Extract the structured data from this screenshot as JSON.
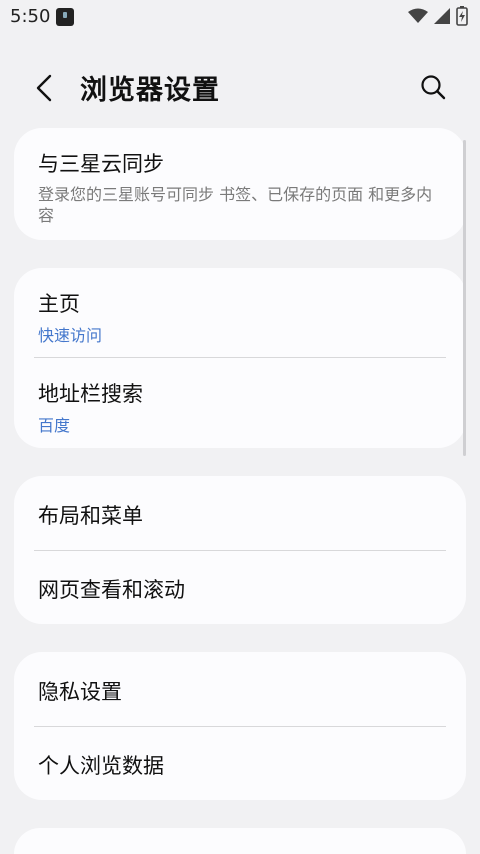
{
  "status_bar": {
    "time": "5:50"
  },
  "header": {
    "title": "浏览器设置"
  },
  "cards": {
    "sync": {
      "title": "与三星云同步",
      "desc": "登录您的三星账号可同步 书签、已保存的页面 和更多内容"
    },
    "home": {
      "title": "主页",
      "sub": "快速访问"
    },
    "address": {
      "title": "地址栏搜索",
      "sub": "百度"
    },
    "layout": {
      "title": "布局和菜单"
    },
    "webview": {
      "title": "网页查看和滚动"
    },
    "privacy": {
      "title": "隐私设置"
    },
    "personal": {
      "title": "个人浏览数据"
    }
  }
}
